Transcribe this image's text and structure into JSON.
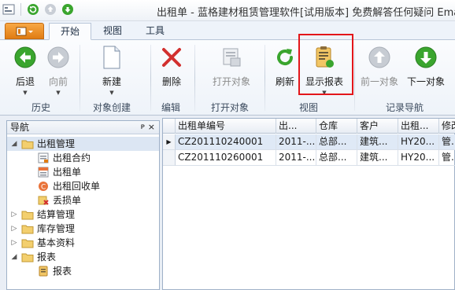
{
  "title": "出租单 - 蓝格建材租赁管理软件[试用版本] 免费解答任何疑问 Ema",
  "tabs": [
    {
      "label": "开始"
    },
    {
      "label": "视图"
    },
    {
      "label": "工具"
    }
  ],
  "ribbon": {
    "back": "后退",
    "forward": "向前",
    "new": "新建",
    "delete": "删除",
    "open": "打开对象",
    "refresh": "刷新",
    "report": "显示报表",
    "prev": "前一对象",
    "next": "下一对象",
    "groups": {
      "history": "历史",
      "create": "对象创建",
      "edit": "编辑",
      "open": "打开对象",
      "view": "视图",
      "record_nav": "记录导航"
    }
  },
  "nav": {
    "title": "导航",
    "pin": "ᴘ",
    "close": "×",
    "items": [
      {
        "label": "出租管理"
      },
      {
        "label": "出租合约"
      },
      {
        "label": "出租单"
      },
      {
        "label": "出租回收单"
      },
      {
        "label": "丢损单"
      },
      {
        "label": "结算管理"
      },
      {
        "label": "库存管理"
      },
      {
        "label": "基本资料"
      },
      {
        "label": "报表"
      },
      {
        "label": "报表"
      }
    ]
  },
  "grid": {
    "columns": [
      "出租单编号",
      "出...",
      "仓库",
      "客户",
      "出租...",
      "修改"
    ],
    "rows": [
      [
        "CZ201110240001",
        "2011-...",
        "总部...",
        "建筑...",
        "HY20...",
        "管..."
      ],
      [
        "CZ201110260001",
        "2011-...",
        "总部...",
        "建筑...",
        "HY20...",
        "管..."
      ]
    ]
  },
  "colors": {
    "accent_orange": "#e07c13",
    "highlight_red": "#e3161a",
    "green": "#3aa52e"
  }
}
